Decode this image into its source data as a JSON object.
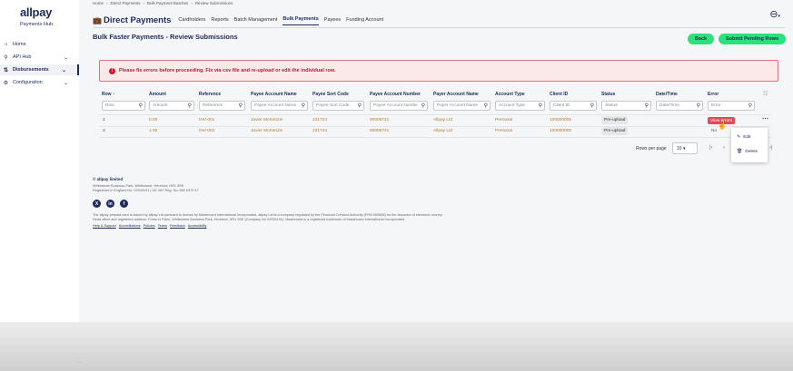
{
  "brand": {
    "name": "allpay",
    "subtitle": "Payments Hub"
  },
  "sidebar": {
    "items": [
      {
        "label": "Home",
        "icon": "home-icon",
        "glyph": "⌂",
        "expandable": false,
        "active": false
      },
      {
        "label": "API Hub",
        "icon": "api-icon",
        "glyph": "⚲",
        "expandable": true,
        "active": false
      },
      {
        "label": "Disbursements",
        "icon": "disbursement-icon",
        "glyph": "⇅",
        "expandable": true,
        "active": true
      },
      {
        "label": "Configuration",
        "icon": "gear-icon",
        "glyph": "⚙",
        "expandable": true,
        "active": false
      }
    ],
    "foot": "..."
  },
  "breadcrumb": [
    "Home",
    "›",
    "Direct Payments",
    "›",
    "Bulk Payment Batches",
    "›",
    "Review Submissions"
  ],
  "topbar": {
    "title": "Direct Payments",
    "tabs": [
      {
        "label": "Cardholders",
        "active": false
      },
      {
        "label": "Reports",
        "active": false
      },
      {
        "label": "Batch Management",
        "active": false
      },
      {
        "label": "Bulk Payments",
        "active": true
      },
      {
        "label": "Payees",
        "active": false
      },
      {
        "label": "Funding Account",
        "active": false
      }
    ]
  },
  "page": {
    "title": "Bulk Faster Payments - Review Submissions",
    "back_label": "Back",
    "submit_label": "Submit Pending Rows"
  },
  "alert": {
    "text": "Please fix errors before proceeding. Fix via csv file and re-upload or edit the individual row."
  },
  "table": {
    "columns": [
      {
        "label": "Row ↑",
        "filter": "Row"
      },
      {
        "label": "Amount",
        "filter": "Amount"
      },
      {
        "label": "Reference",
        "filter": "Reference"
      },
      {
        "label": "Payee Account Name",
        "filter": "Payee Account Name"
      },
      {
        "label": "Payee Sort Code",
        "filter": "Payee Sort Code"
      },
      {
        "label": "Payee Account Number",
        "filter": "Payee Account Numbe"
      },
      {
        "label": "Payer Account Name",
        "filter": "Payer Account Name"
      },
      {
        "label": "Account Type",
        "filter": "Account Type"
      },
      {
        "label": "Client ID",
        "filter": "Client ID"
      },
      {
        "label": "Status",
        "filter": "Status"
      },
      {
        "label": "Date/Time",
        "filter": "Date/Time"
      },
      {
        "label": "Error",
        "filter": "Error"
      }
    ],
    "rows": [
      {
        "cells": [
          "2",
          "0.00",
          "INV-001",
          "Javier McKenzie",
          "231724",
          "90008741",
          "Allpay Ltd",
          "Personal",
          "100000005",
          "Pre-upload",
          "",
          "View errors"
        ]
      },
      {
        "cells": [
          "3",
          "1.00",
          "INV-002",
          "Javier McKenzie",
          "231724",
          "90008741",
          "Allpay Ltd",
          "Personal",
          "100000005",
          "Pre-upload",
          "",
          "No"
        ]
      }
    ],
    "row_menu": {
      "edit": "Edit",
      "delete": "Delete"
    },
    "pagination": {
      "rows_label": "Rows per page",
      "rows_value": "10 ▾",
      "first": "|‹",
      "prev": "‹",
      "next": "›",
      "last": "›|"
    }
  },
  "footer": {
    "company": "© allpay limited",
    "address": "Whitestone Business Park, Whitestone, Hereford, HR1 3SE",
    "registered": "Registered in England No. 02933191 | UK VAT Reg. No. 650 5379 47",
    "social": [
      {
        "icon": "x-icon",
        "glyph": "X"
      },
      {
        "icon": "linkedin-icon",
        "glyph": "in"
      },
      {
        "icon": "facebook-icon",
        "glyph": "f"
      }
    ],
    "legal1": "The allpay prepaid card is issued by allpay Ltd pursuant to license by Mastercard International Incorporated. allpay Ltd is a company regulated by the Financial Conduct Authority (FRN 900608) for the issuance of electronic money.",
    "legal2": "Head office and registered address: Fortis et Fides, Whitestone Business Park, Hereford, HR1 3SE (Company No 02933191). Mastercard is a registered trademark of Mastercard International Incorporated.",
    "links": [
      "Help & Support",
      "Accreditations",
      "Policies",
      "Terms",
      "Feedback",
      "Accessibility"
    ]
  }
}
